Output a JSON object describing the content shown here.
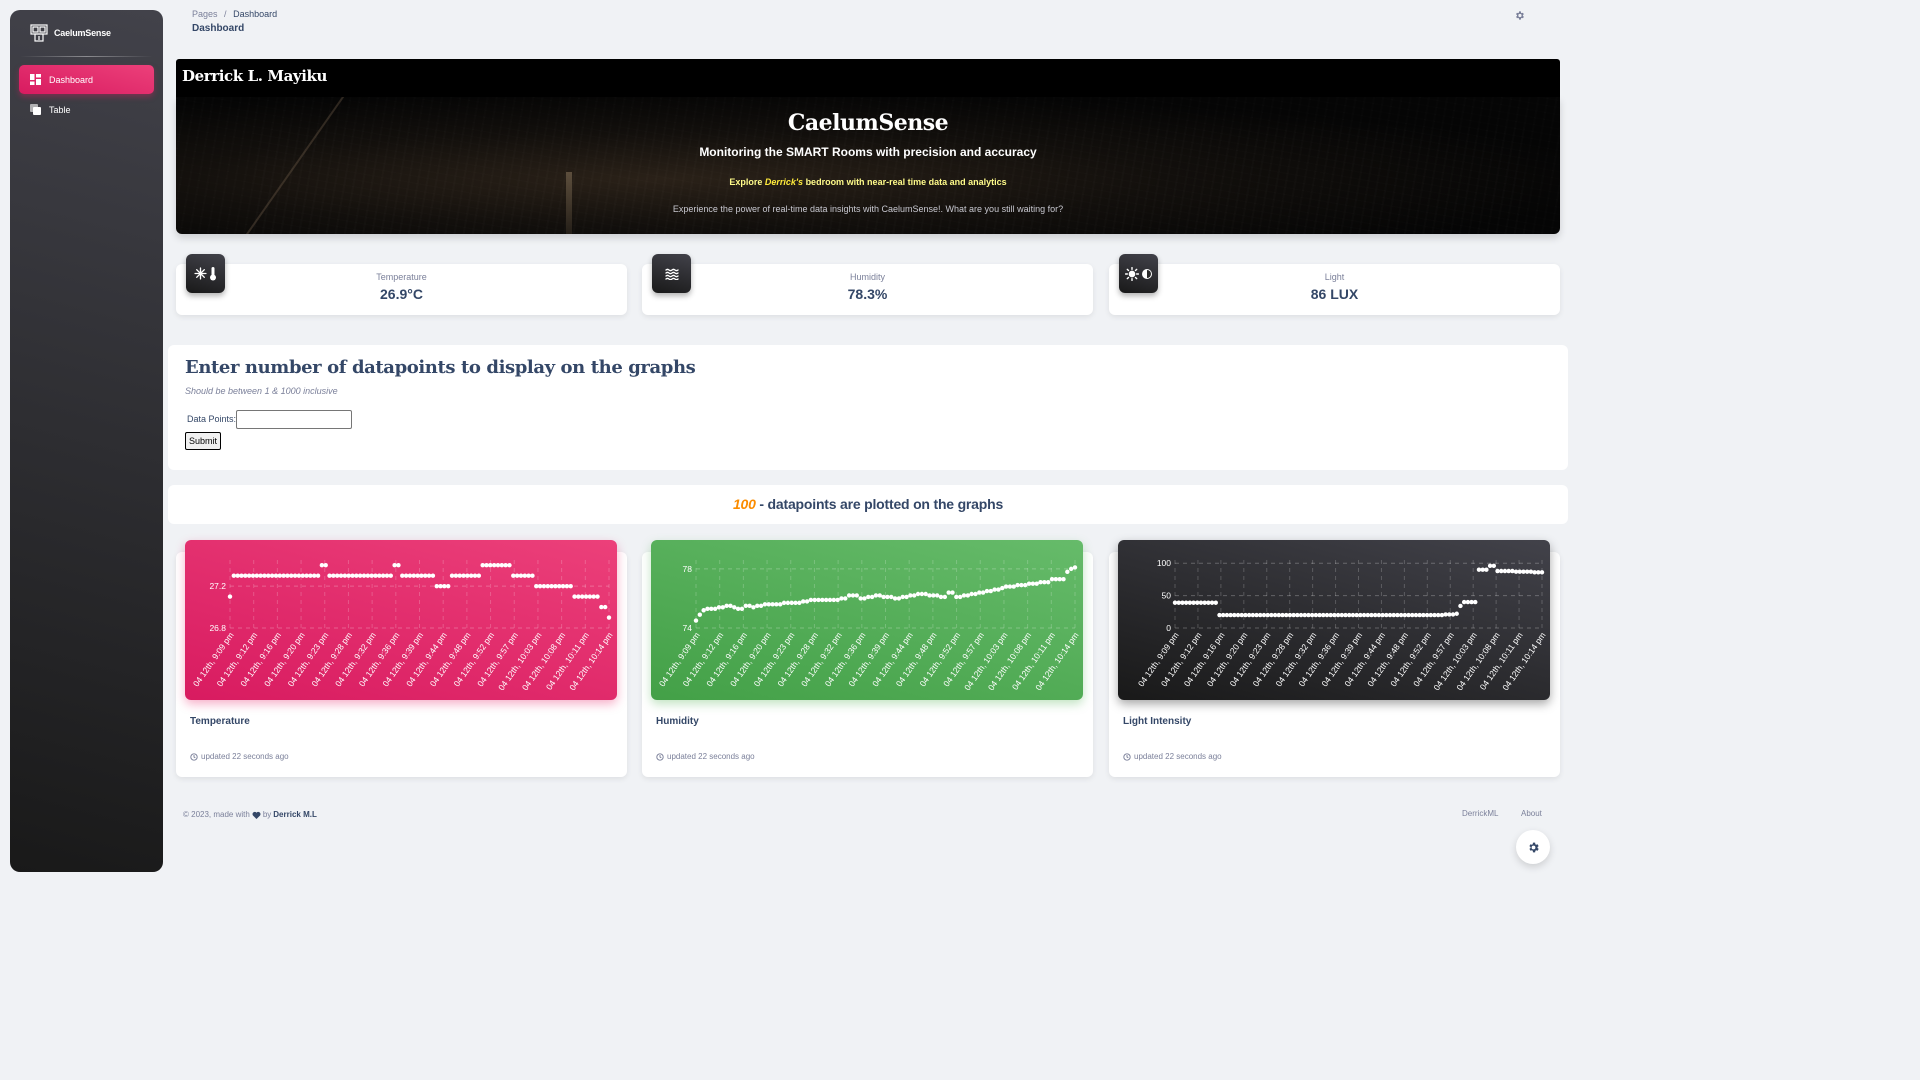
{
  "sidebar": {
    "brand": "CaelumSense",
    "items": [
      {
        "label": "Dashboard",
        "icon": "dashboard-icon",
        "active": true
      },
      {
        "label": "Table",
        "icon": "table-icon",
        "active": false
      }
    ]
  },
  "header": {
    "breadcrumb_root": "Pages",
    "breadcrumb_sep": "/",
    "breadcrumb_current": "Dashboard",
    "page_title": "Dashboard"
  },
  "hero": {
    "owner": "Derrick L. Mayiku",
    "title": "CaelumSense",
    "subtitle": "Monitoring the SMART Rooms with precision and accuracy",
    "explore_prefix": "Explore ",
    "explore_name": "Derrick's",
    "explore_suffix": " bedroom with near-real time data and analytics",
    "tagline": "Experience the power of real-time data insights with CaelumSense!. What are you still waiting for?"
  },
  "stats": [
    {
      "label": "Temperature",
      "value": "26.9°C",
      "icon": "temperature-icon"
    },
    {
      "label": "Humidity",
      "value": "78.3%",
      "icon": "humidity-icon"
    },
    {
      "label": "Light",
      "value": "86 LUX",
      "icon": "light-icon"
    }
  ],
  "datapoint_form": {
    "heading": "Enter number of datapoints to display on the graphs",
    "hint": "Should be between 1 & 1000 inclusive",
    "field_label": "Data Points:",
    "field_value": "",
    "submit_label": "Submit"
  },
  "plotted": {
    "count": "100",
    "text": " - datapoints are plotted on the graphs"
  },
  "charts": [
    {
      "title": "Temperature",
      "updated": "updated 22 seconds ago",
      "color": "#e91e63"
    },
    {
      "title": "Humidity",
      "updated": "updated 22 seconds ago",
      "color": "#4caf50"
    },
    {
      "title": "Light Intensity",
      "updated": "updated 22 seconds ago",
      "color": "#262626"
    }
  ],
  "chart_data": [
    {
      "type": "line",
      "title": "Temperature",
      "x_labels": [
        "04 12th, 9:09 pm",
        "04 12th, 9:12 pm",
        "04 12th, 9:16 pm",
        "04 12th, 9:20 pm",
        "04 12th, 9:23 pm",
        "04 12th, 9:28 pm",
        "04 12th, 9:32 pm",
        "04 12th, 9:36 pm",
        "04 12th, 9:39 pm",
        "04 12th, 9:44 pm",
        "04 12th, 9:48 pm",
        "04 12th, 9:52 pm",
        "04 12th, 9:57 pm",
        "04 12th, 10:03 pm",
        "04 12th, 10:08 pm",
        "04 12th, 10:11 pm",
        "04 12th, 10:14 pm"
      ],
      "y_ticks": [
        26.8,
        27.2
      ],
      "ylim": [
        26.8,
        27.45
      ],
      "values": [
        27.1,
        27.3,
        27.3,
        27.3,
        27.3,
        27.3,
        27.3,
        27.3,
        27.3,
        27.3,
        27.3,
        27.3,
        27.3,
        27.3,
        27.3,
        27.3,
        27.3,
        27.3,
        27.3,
        27.3,
        27.3,
        27.3,
        27.3,
        27.3,
        27.4,
        27.4,
        27.3,
        27.3,
        27.3,
        27.3,
        27.3,
        27.3,
        27.3,
        27.3,
        27.3,
        27.3,
        27.3,
        27.3,
        27.3,
        27.3,
        27.3,
        27.3,
        27.3,
        27.4,
        27.4,
        27.3,
        27.3,
        27.3,
        27.3,
        27.3,
        27.3,
        27.3,
        27.3,
        27.3,
        27.2,
        27.2,
        27.2,
        27.2,
        27.3,
        27.3,
        27.3,
        27.3,
        27.3,
        27.3,
        27.3,
        27.3,
        27.4,
        27.4,
        27.4,
        27.4,
        27.4,
        27.4,
        27.4,
        27.4,
        27.3,
        27.3,
        27.3,
        27.3,
        27.3,
        27.3,
        27.2,
        27.2,
        27.2,
        27.2,
        27.2,
        27.2,
        27.2,
        27.2,
        27.2,
        27.2,
        27.1,
        27.1,
        27.1,
        27.1,
        27.1,
        27.1,
        27.1,
        27.0,
        27.0,
        26.9
      ]
    },
    {
      "type": "line",
      "title": "Humidity",
      "x_labels": [
        "04 12th, 9:09 pm",
        "04 12th, 9:12 pm",
        "04 12th, 9:16 pm",
        "04 12th, 9:20 pm",
        "04 12th, 9:23 pm",
        "04 12th, 9:28 pm",
        "04 12th, 9:32 pm",
        "04 12th, 9:36 pm",
        "04 12th, 9:39 pm",
        "04 12th, 9:44 pm",
        "04 12th, 9:48 pm",
        "04 12th, 9:52 pm",
        "04 12th, 9:57 pm",
        "04 12th, 10:03 pm",
        "04 12th, 10:08 pm",
        "04 12th, 10:11 pm",
        "04 12th, 10:14 pm"
      ],
      "y_ticks": [
        74,
        78
      ],
      "ylim": [
        74,
        78.6
      ],
      "values": [
        74.5,
        74.9,
        75.2,
        75.3,
        75.3,
        75.3,
        75.4,
        75.4,
        75.5,
        75.5,
        75.4,
        75.3,
        75.3,
        75.5,
        75.5,
        75.4,
        75.5,
        75.5,
        75.6,
        75.6,
        75.6,
        75.6,
        75.6,
        75.7,
        75.7,
        75.7,
        75.7,
        75.7,
        75.8,
        75.8,
        75.9,
        75.9,
        75.9,
        75.9,
        75.9,
        75.9,
        75.9,
        75.9,
        76.0,
        76.0,
        76.2,
        76.2,
        76.2,
        76.0,
        76.0,
        76.1,
        76.1,
        76.2,
        76.2,
        76.1,
        76.1,
        76.1,
        76.0,
        76.0,
        76.1,
        76.1,
        76.2,
        76.2,
        76.3,
        76.3,
        76.3,
        76.2,
        76.2,
        76.2,
        76.1,
        76.1,
        76.4,
        76.4,
        76.1,
        76.1,
        76.2,
        76.2,
        76.3,
        76.3,
        76.4,
        76.4,
        76.5,
        76.5,
        76.6,
        76.6,
        76.7,
        76.8,
        76.8,
        76.8,
        76.9,
        76.9,
        76.9,
        77.0,
        77.0,
        77.0,
        77.1,
        77.1,
        77.1,
        77.3,
        77.3,
        77.3,
        77.3,
        77.8,
        78.0,
        78.1
      ]
    },
    {
      "type": "line",
      "title": "Light Intensity",
      "x_labels": [
        "04 12th, 9:09 pm",
        "04 12th, 9:12 pm",
        "04 12th, 9:16 pm",
        "04 12th, 9:20 pm",
        "04 12th, 9:23 pm",
        "04 12th, 9:28 pm",
        "04 12th, 9:32 pm",
        "04 12th, 9:36 pm",
        "04 12th, 9:39 pm",
        "04 12th, 9:44 pm",
        "04 12th, 9:48 pm",
        "04 12th, 9:52 pm",
        "04 12th, 9:57 pm",
        "04 12th, 10:03 pm",
        "04 12th, 10:08 pm",
        "04 12th, 10:11 pm",
        "04 12th, 10:14 pm"
      ],
      "y_ticks": [
        0,
        50,
        100
      ],
      "ylim": [
        0,
        105
      ],
      "values": [
        39,
        39,
        39,
        39,
        39,
        39,
        39,
        39,
        39,
        39,
        39,
        39,
        20,
        20,
        20,
        20,
        20,
        20,
        20,
        20,
        20,
        20,
        20,
        20,
        20,
        20,
        20,
        20,
        20,
        20,
        20,
        20,
        20,
        20,
        20,
        20,
        20,
        20,
        20,
        20,
        20,
        20,
        20,
        20,
        20,
        20,
        20,
        20,
        20,
        20,
        20,
        20,
        20,
        20,
        20,
        20,
        20,
        20,
        20,
        20,
        20,
        20,
        20,
        20,
        20,
        20,
        20,
        20,
        20,
        20,
        20,
        20,
        20,
        21,
        21,
        21,
        22,
        34,
        40,
        40,
        40,
        40,
        90,
        90,
        90,
        96,
        96,
        88,
        88,
        88,
        88,
        88,
        87,
        87,
        87,
        87,
        87,
        86,
        86,
        86
      ]
    }
  ],
  "footer": {
    "copyright": "© 2023, made with",
    "by": "by",
    "author": "Derrick M.L",
    "links": [
      "DerrickML",
      "About"
    ]
  }
}
